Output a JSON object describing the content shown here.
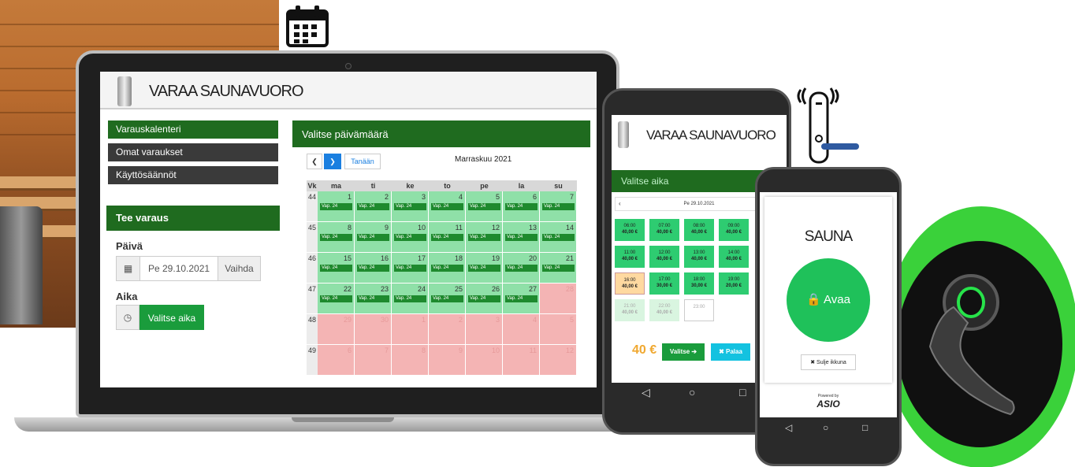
{
  "laptop_app": {
    "brand_title": "VARAA SAUNAVUORO",
    "menu": [
      {
        "label": "Varauskalenteri",
        "active": true
      },
      {
        "label": "Omat varaukset",
        "active": false
      },
      {
        "label": "Käyttösäännöt",
        "active": false
      }
    ],
    "booking": {
      "heading": "Tee varaus",
      "day_label": "Päivä",
      "day_value": "Pe 29.10.2021",
      "change_button": "Vaihda",
      "time_label": "Aika",
      "choose_time_button": "Valitse aika"
    },
    "calendar": {
      "heading": "Valitse päivämäärä",
      "prev_label": "❮",
      "next_label": "❯",
      "today_label": "Tanään",
      "month_title": "Marraskuu 2021",
      "week_header": "Vk",
      "day_headers": [
        "ma",
        "ti",
        "ke",
        "to",
        "pe",
        "la",
        "su"
      ],
      "weeks": [
        {
          "week": "44",
          "days": [
            "1",
            "2",
            "3",
            "4",
            "5",
            "6",
            "7"
          ]
        },
        {
          "week": "45",
          "days": [
            "8",
            "9",
            "10",
            "11",
            "12",
            "13",
            "14"
          ]
        },
        {
          "week": "46",
          "days": [
            "15",
            "16",
            "17",
            "18",
            "19",
            "20",
            "21"
          ]
        },
        {
          "week": "47",
          "days": [
            "22",
            "23",
            "24",
            "25",
            "26",
            "27",
            "28"
          ]
        },
        {
          "week": "48",
          "days": [
            "29",
            "30",
            "1",
            "2",
            "3",
            "4",
            "5"
          ]
        },
        {
          "week": "49",
          "days": [
            "6",
            "7",
            "8",
            "9",
            "10",
            "11",
            "12"
          ]
        }
      ],
      "free_tag": "Vap. 24"
    }
  },
  "phone1": {
    "brand_title": "VARAA SAUNAVUORO",
    "heading": "Valitse aika",
    "date_prev": "‹",
    "date_value": "Pe 29.10.2021",
    "slots": [
      {
        "time": "06:00",
        "price": "40,00 €",
        "state": "free"
      },
      {
        "time": "07:00",
        "price": "40,00 €",
        "state": "free"
      },
      {
        "time": "08:00",
        "price": "40,00 €",
        "state": "free"
      },
      {
        "time": "09:00",
        "price": "40,00 €",
        "state": "free"
      },
      {
        "time": "11:00",
        "price": "40,00 €",
        "state": "free"
      },
      {
        "time": "12:00",
        "price": "40,00 €",
        "state": "free"
      },
      {
        "time": "13:00",
        "price": "40,00 €",
        "state": "free"
      },
      {
        "time": "14:00",
        "price": "40,00 €",
        "state": "free"
      },
      {
        "time": "16:00",
        "price": "40,00 €",
        "state": "selected"
      },
      {
        "time": "17:00",
        "price": "30,00 €",
        "state": "free"
      },
      {
        "time": "18:00",
        "price": "30,00 €",
        "state": "free"
      },
      {
        "time": "19:00",
        "price": "20,00 €",
        "state": "free"
      },
      {
        "time": "21:00",
        "price": "40,00 €",
        "state": "faded"
      },
      {
        "time": "22:00",
        "price": "40,00 €",
        "state": "faded"
      },
      {
        "time": "23:00",
        "price": "",
        "state": "empty"
      }
    ],
    "total_price": "40 €",
    "select_button": "Valitse ➔",
    "back_button": "✖ Palaa"
  },
  "phone2": {
    "title": "SAUNA",
    "open_button": "🔒 Avaa",
    "close_window_button": "✖ Sulje ikkuna",
    "powered_by": "Powered by",
    "brand": "ASIO"
  },
  "nav_icons": {
    "back": "◁",
    "home": "○",
    "recent": "□"
  },
  "colors": {
    "brand_green": "#1f6b1f",
    "action_green": "#1a9c3c",
    "free_day": "#8fe0a8",
    "booked_day": "#f4b4b4",
    "price_orange": "#f0a830",
    "back_cyan": "#13c2e0"
  },
  "icons": [
    "calendar-icon",
    "smart-lock-icon",
    "door-handle-icon",
    "sauna-can-icon",
    "clock-icon",
    "lock-icon"
  ]
}
